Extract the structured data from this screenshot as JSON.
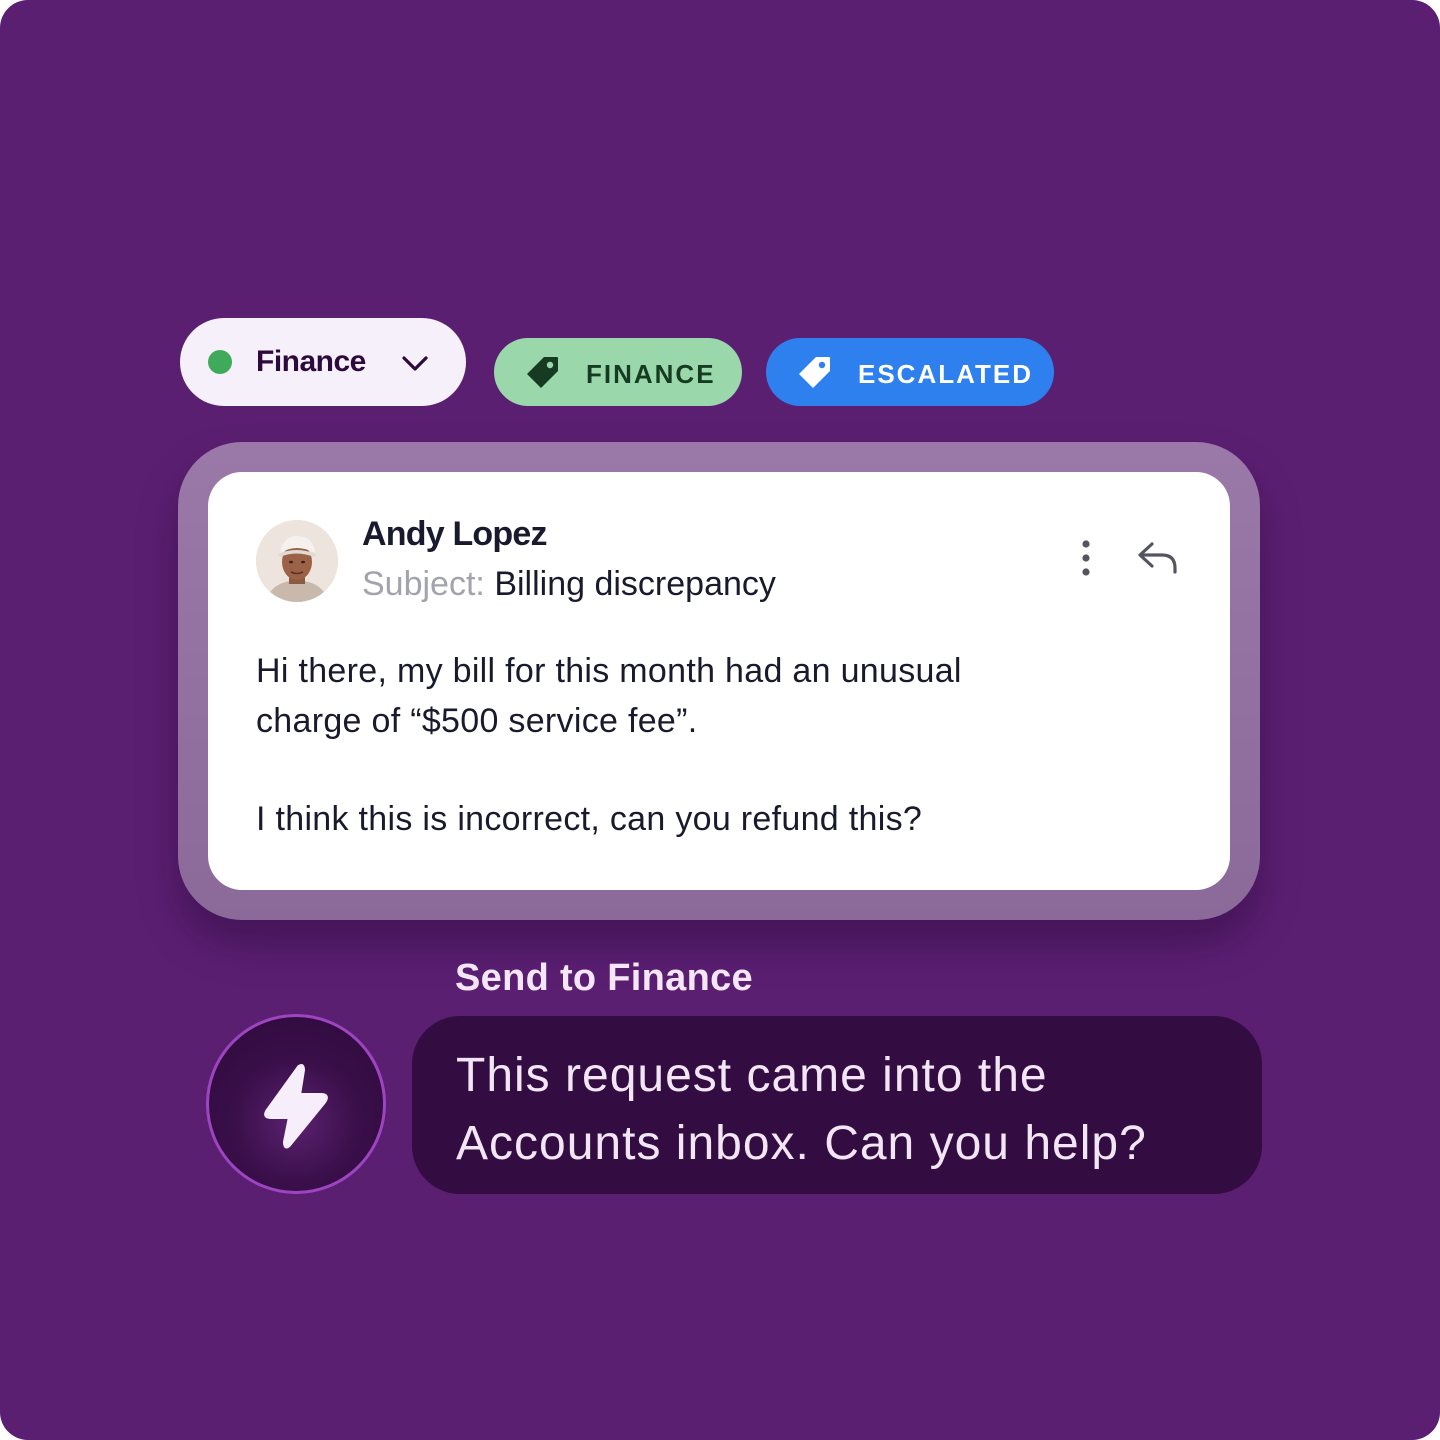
{
  "team_selector": {
    "label": "Finance",
    "status_color": "#3faa5a"
  },
  "tags": [
    {
      "label": "FINANCE",
      "icon": "tag-icon",
      "background": "#9ad8ab",
      "text_color": "#163b22"
    },
    {
      "label": "ESCALATED",
      "icon": "tag-icon",
      "background": "#2e80ee",
      "text_color": "#ffffff"
    }
  ],
  "message": {
    "sender_name": "Andy Lopez",
    "subject_label": "Subject:",
    "subject": "Billing discrepancy",
    "body_line_1": "Hi there, my bill for this month had an unusual",
    "body_line_2": "charge of “$500 service fee”.",
    "body_paragraph_2": "I think this is incorrect, can you refund this?",
    "actions": [
      "more-options-icon",
      "reply-icon"
    ]
  },
  "suggestion": {
    "title": "Send to Finance",
    "icon": "lightning-bolt-icon",
    "text_line_1": "This request came into the",
    "text_line_2": "Accounts inbox. Can you help?"
  },
  "colors": {
    "background": "#5b1f72",
    "bubble": "#330c42",
    "accent_border": "#9d45c0"
  }
}
